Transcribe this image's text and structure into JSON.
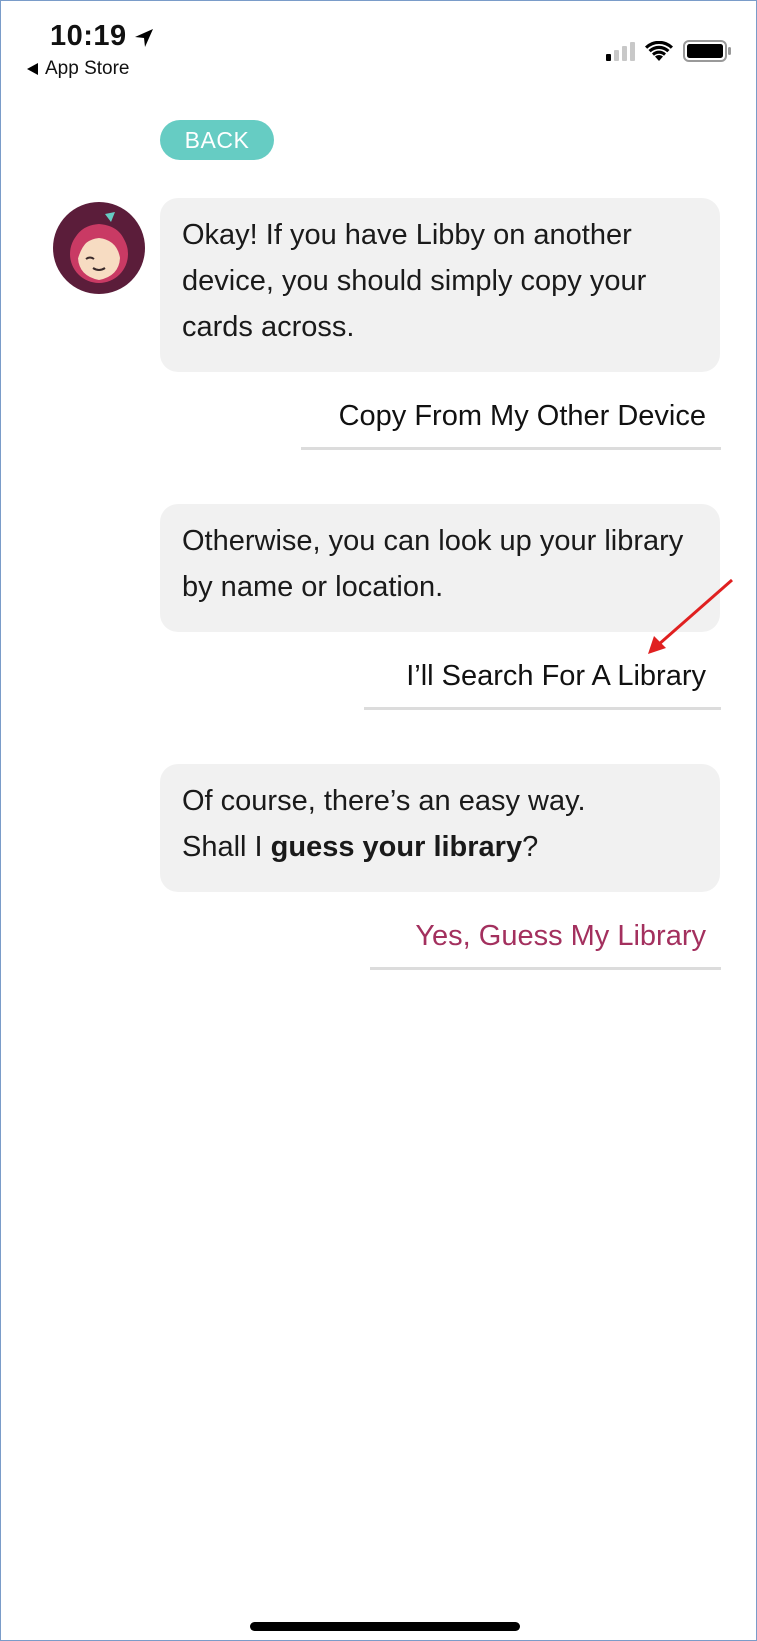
{
  "status_bar": {
    "time": "10:19",
    "back_app_label": "App Store"
  },
  "back_button": {
    "label": "BACK"
  },
  "messages": [
    {
      "text": "Okay! If you have Libby on another device, you should simply copy your cards across."
    },
    {
      "text": "Otherwise, you can look up your library by name or location."
    },
    {
      "line1": "Of course, there’s an easy way.",
      "line2_prefix": "Shall I ",
      "line2_bold": "guess your library",
      "line2_suffix": "?"
    }
  ],
  "options": [
    {
      "label": "Copy From My Other Device"
    },
    {
      "label": "I’ll Search For A Library"
    },
    {
      "label": "Yes, Guess My Library"
    }
  ],
  "colors": {
    "accent_teal": "#66ccc3",
    "highlight_option": "#a3305e",
    "avatar_bg": "#5b1d3a",
    "annotation_arrow": "#e02020"
  }
}
